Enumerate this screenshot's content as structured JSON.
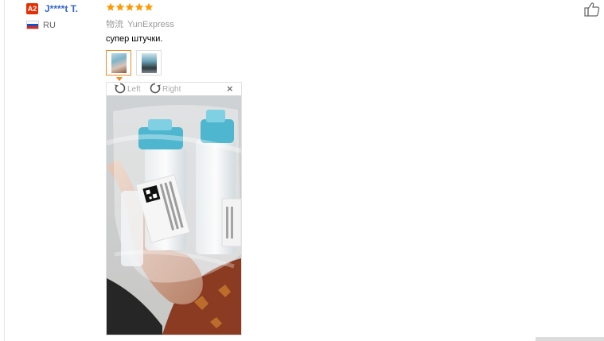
{
  "reviewer": {
    "badge": "A2",
    "name": "J****t T.",
    "country": "RU"
  },
  "review": {
    "rating": 5,
    "shipping_label": "物流",
    "shipping_value": "YunExpress",
    "text": "супер штучки."
  },
  "photos": {
    "thumbnails": [
      "photo-1",
      "photo-2"
    ],
    "selected_index": 0
  },
  "viewer": {
    "rotate_left_label": "Left",
    "rotate_right_label": "Right",
    "close_label": "×"
  },
  "colors": {
    "star": "#ff9900",
    "accent": "#f08a24",
    "badge": "#e62e04",
    "link": "#3366cc"
  }
}
